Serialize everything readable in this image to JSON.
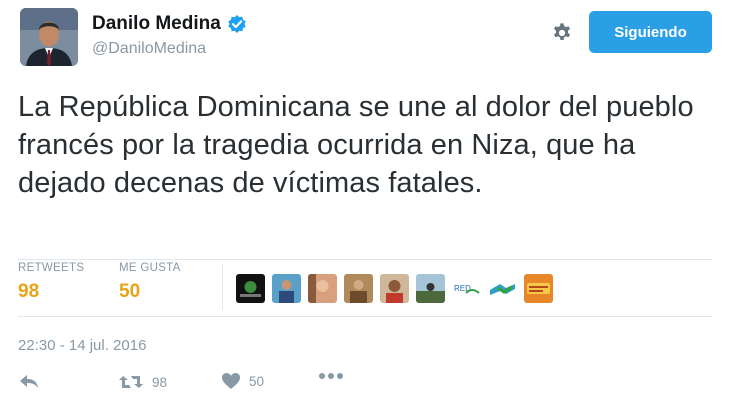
{
  "tweet": {
    "author": {
      "name": "Danilo Medina",
      "handle": "@DaniloMedina",
      "verified": true
    },
    "follow_button": "Siguiendo",
    "text": "La República Dominicana se une al dolor del pueblo francés por la tragedia ocurrida en Niza, que ha dejado decenas de víctimas fatales.",
    "stats": {
      "retweets_label": "RETWEETS",
      "retweets_value": "98",
      "likes_label": "ME GUSTA",
      "likes_value": "50"
    },
    "likers_count": 9,
    "timestamp": "22:30 - 14 jul. 2016",
    "actions": {
      "retweet_count": "98",
      "like_count": "50"
    }
  },
  "colors": {
    "accent": "#2b9fe6",
    "stat_value": "#e8a317",
    "muted": "#8899a6",
    "verified": "#1da1f2"
  },
  "icons": [
    "avatar",
    "verified-badge-icon",
    "gear-icon",
    "reply-icon",
    "retweet-icon",
    "heart-icon",
    "more-icon"
  ]
}
